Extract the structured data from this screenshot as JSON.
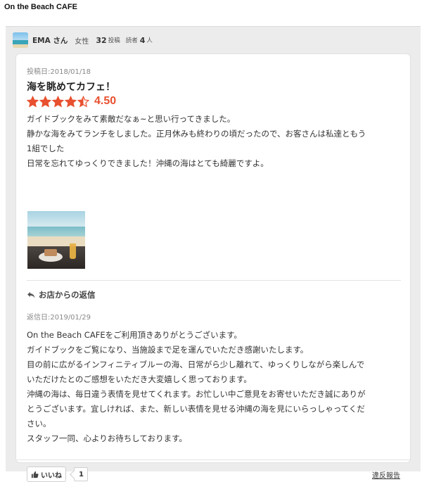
{
  "shop": {
    "name": "On the Beach CAFE"
  },
  "reviewer": {
    "avatar_icon": "beach-photo-avatar",
    "name": "EMA さん",
    "gender": "女性",
    "post_count": "32",
    "post_label": "投稿",
    "reader_label": "読者",
    "reader_count": "4",
    "reader_unit": "人"
  },
  "review": {
    "post_date": "投稿日:2018/01/18",
    "title": "海を眺めてカフェ！",
    "rating": "4.50",
    "rating_fraction": 0.9,
    "star_color": "#e8502f",
    "body": [
      "ガイドブックをみて素敵だなぁ~と思い行ってきました。",
      "静かな海をみてランチをしました。正月休みも終わりの頃だったので、お客さんは私達ともう",
      "1組でした",
      "日常を忘れてゆっくりできました！沖縄の海はとても綺麗ですよ。"
    ],
    "photo_icon": "cafe-beach-photo"
  },
  "reply": {
    "icon": "reply-arrow-icon",
    "heading": "お店からの返信",
    "date": "返信日:2019/01/29",
    "body": [
      "On the Beach CAFEをご利用頂きありがとうございます。",
      "ガイドブックをご覧になり、当施設まで足を運んでいただき感謝いたします。",
      "目の前に広がるインフィニティブルーの海、日常がら少し離れて、ゆっくりしながら楽しんで",
      "いただけたとのご感想をいただき大変嬉しく思っております。",
      "沖縄の海は、毎日違う表情を見せてくれます。お忙しい中ご意見をお寄せいただき誠にありが",
      "とうございます。宜しければ、また、新しい表情を見せる沖縄の海を見にいらっしゃってくだ",
      "さい。",
      "スタッフ一同、心よりお待ちしております。"
    ]
  },
  "footer": {
    "like_label": "いいね",
    "like_count": "1",
    "report_label": "違反報告",
    "like_icon": "thumbs-up-icon"
  }
}
